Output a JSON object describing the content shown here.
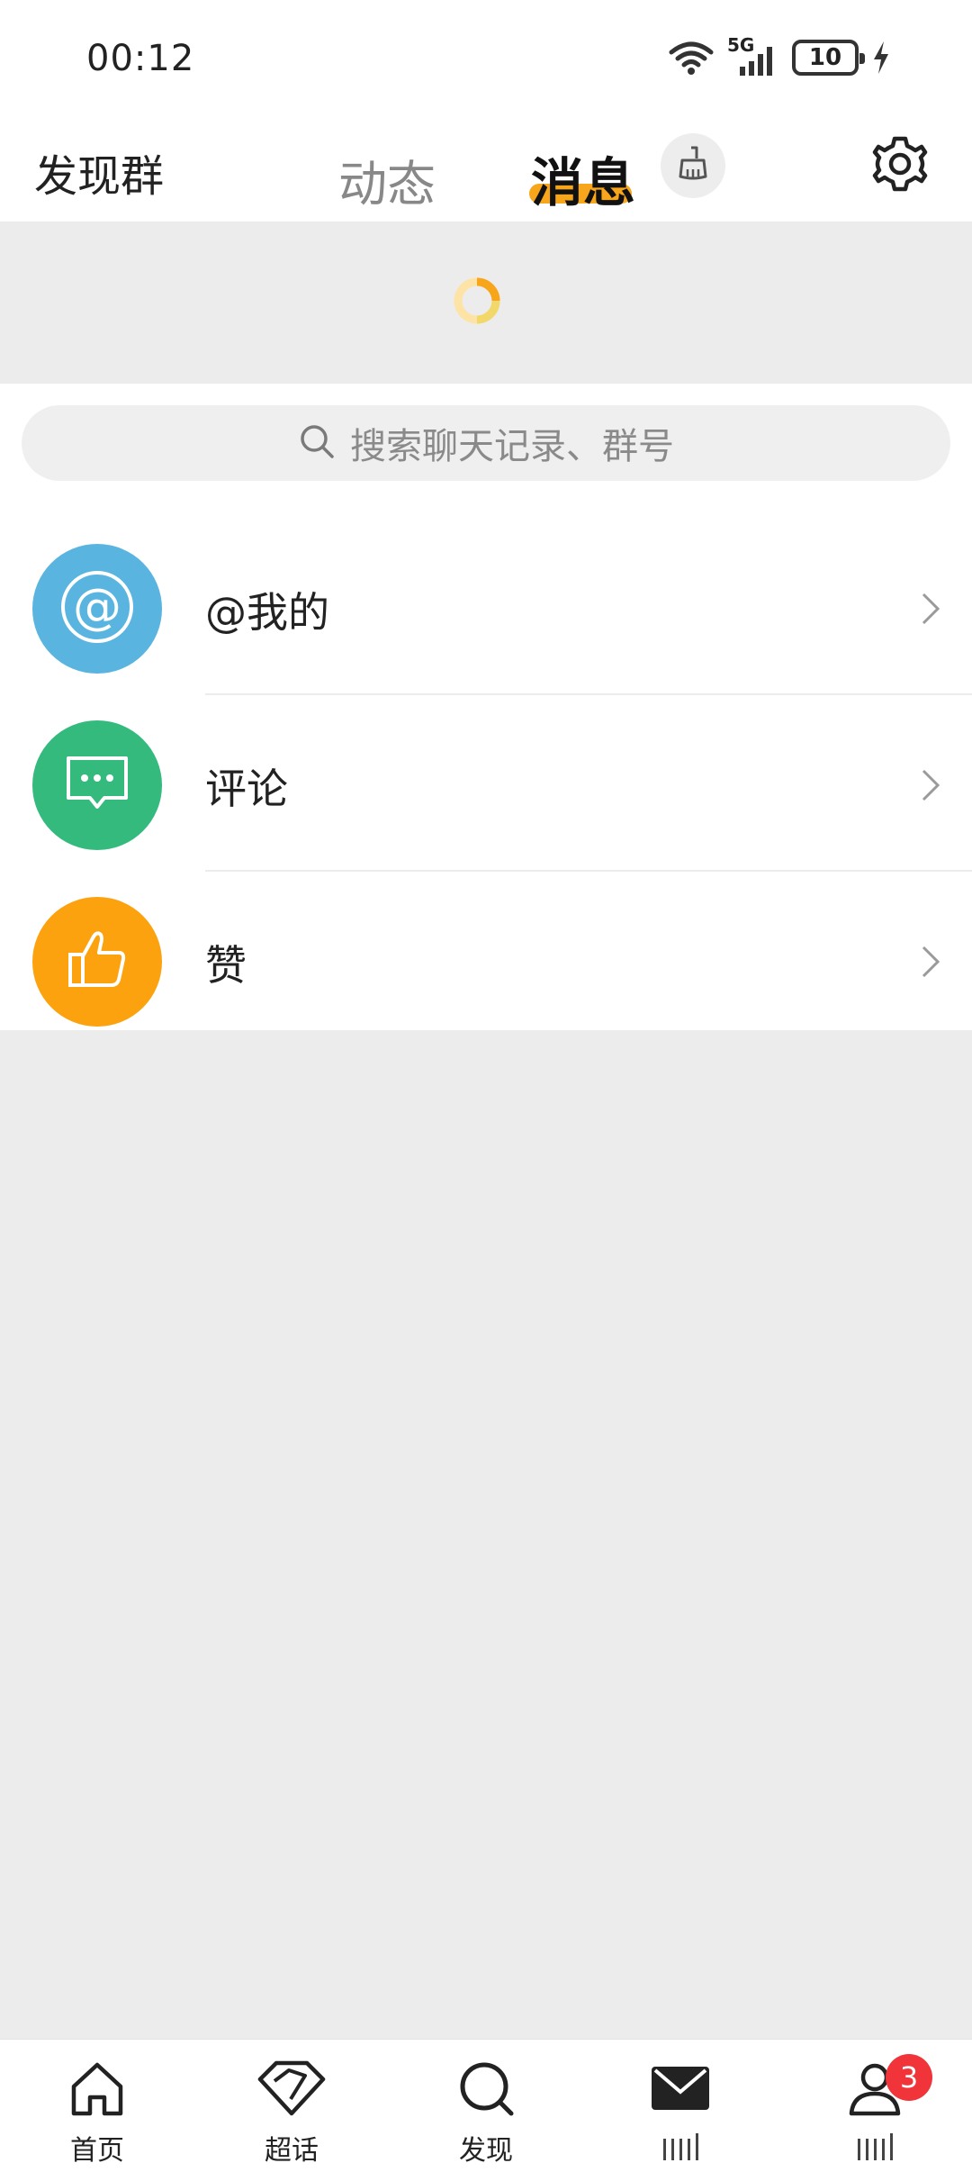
{
  "status_bar": {
    "time": "00:12",
    "network": "5G",
    "battery": "10"
  },
  "header": {
    "left_link": "发现群",
    "tabs": [
      {
        "label": "动态",
        "active": false
      },
      {
        "label": "消息",
        "active": true
      }
    ],
    "accent_color": "#f7a51b"
  },
  "search": {
    "placeholder": "搜索聊天记录、群号"
  },
  "list": [
    {
      "label": "@我的",
      "icon": "at-icon",
      "color": "#5ab4e0"
    },
    {
      "label": "评论",
      "icon": "comment-icon",
      "color": "#35ba7e"
    },
    {
      "label": "赞",
      "icon": "thumbs-up-icon",
      "color": "#fca20f"
    }
  ],
  "bottom_nav": [
    {
      "label": "首页",
      "icon": "home-icon"
    },
    {
      "label": "超话",
      "icon": "diamond-icon"
    },
    {
      "label": "发现",
      "icon": "search-icon"
    },
    {
      "label": "",
      "icon": "mail-icon",
      "active": true
    },
    {
      "label": "",
      "icon": "profile-icon",
      "badge": "3"
    }
  ]
}
